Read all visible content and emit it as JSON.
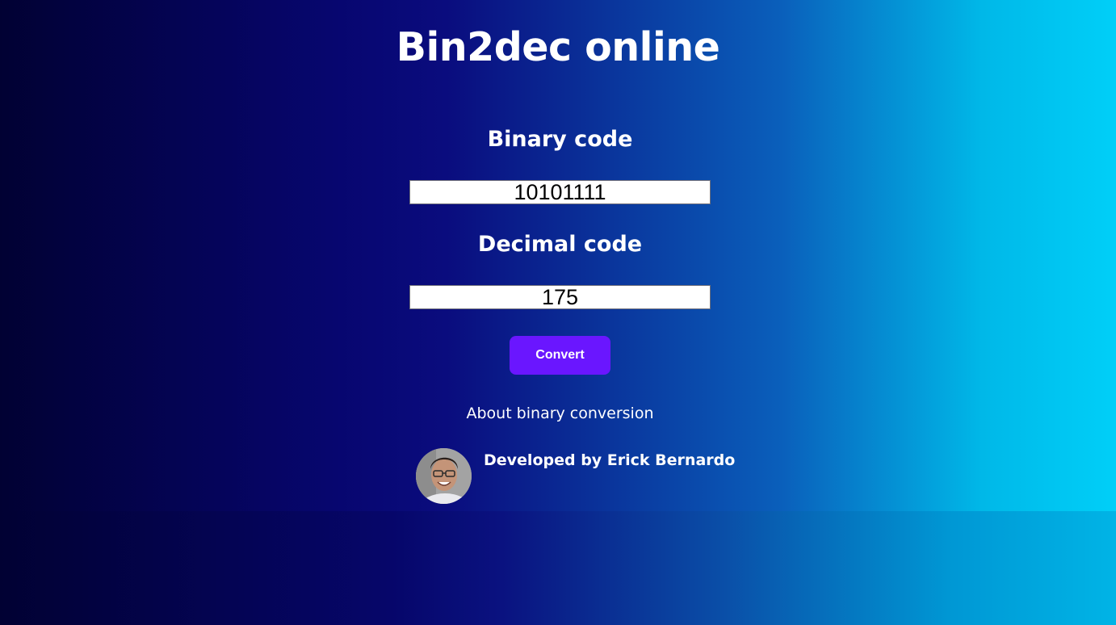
{
  "page": {
    "title": "Bin2dec online"
  },
  "binary": {
    "label": "Binary code",
    "value": "10101111"
  },
  "decimal": {
    "label": "Decimal code",
    "value": "175"
  },
  "convert": {
    "label": "Convert"
  },
  "about": {
    "link_text": "About binary conversion"
  },
  "footer": {
    "credit": "Developed by Erick Bernardo",
    "avatar_icon": "avatar-photo"
  },
  "colors": {
    "button": "#6a16ff",
    "gradient_start": "#010133",
    "gradient_mid": "#0a0c7e",
    "gradient_end": "#00cff8"
  }
}
